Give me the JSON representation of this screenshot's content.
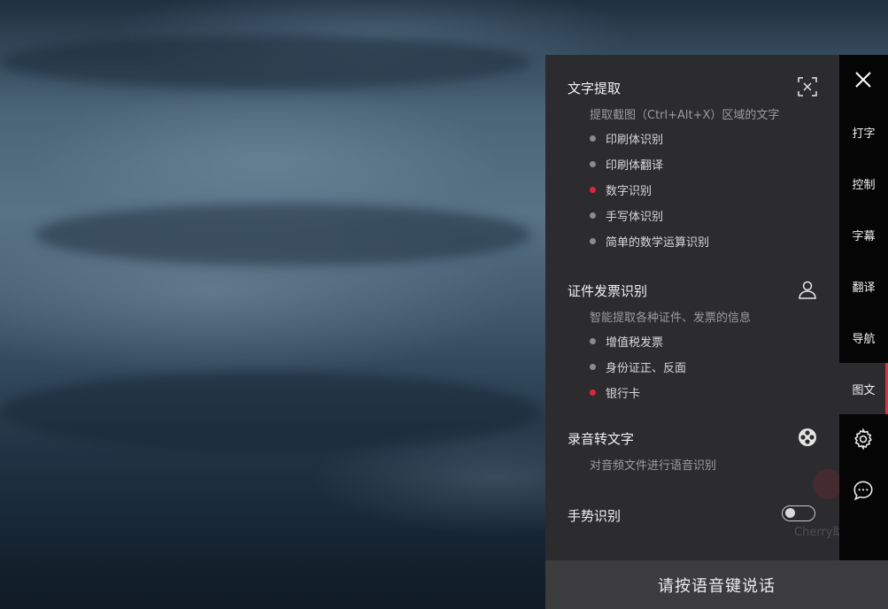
{
  "sections": {
    "text_extract": {
      "title": "文字提取",
      "description": "提取截图（Ctrl+Alt+X）区域的文字",
      "icon": "scan-text-icon",
      "items": [
        {
          "label": "印刷体识别",
          "active": false
        },
        {
          "label": "印刷体翻译",
          "active": false
        },
        {
          "label": "数字识别",
          "active": true
        },
        {
          "label": "手写体识别",
          "active": false
        },
        {
          "label": "简单的数学运算识别",
          "active": false
        }
      ]
    },
    "id_invoice": {
      "title": "证件发票识别",
      "description": "智能提取各种证件、发票的信息",
      "icon": "person-icon",
      "items": [
        {
          "label": "增值税发票",
          "active": false
        },
        {
          "label": "身份证正、反面",
          "active": false
        },
        {
          "label": "银行卡",
          "active": true
        }
      ]
    },
    "audio_to_text": {
      "title": "录音转文字",
      "description": "对音频文件进行语音识别",
      "icon": "film-reel-icon"
    },
    "gesture": {
      "title": "手势识别",
      "enabled": false
    }
  },
  "watermark": "Cherry助手",
  "sidebar": {
    "close_icon": "close-icon",
    "tabs": [
      {
        "label": "打字",
        "active": false
      },
      {
        "label": "控制",
        "active": false
      },
      {
        "label": "字幕",
        "active": false
      },
      {
        "label": "翻译",
        "active": false
      },
      {
        "label": "导航",
        "active": false
      },
      {
        "label": "图文",
        "active": true
      }
    ],
    "settings_icon": "gear-icon",
    "chat_icon": "chat-bubble-icon"
  },
  "bottom_bar": {
    "label": "请按语音键说话"
  },
  "colors": {
    "accent": "#e0233d",
    "panel": "#2c2c2e",
    "sidebar": "#050505"
  }
}
